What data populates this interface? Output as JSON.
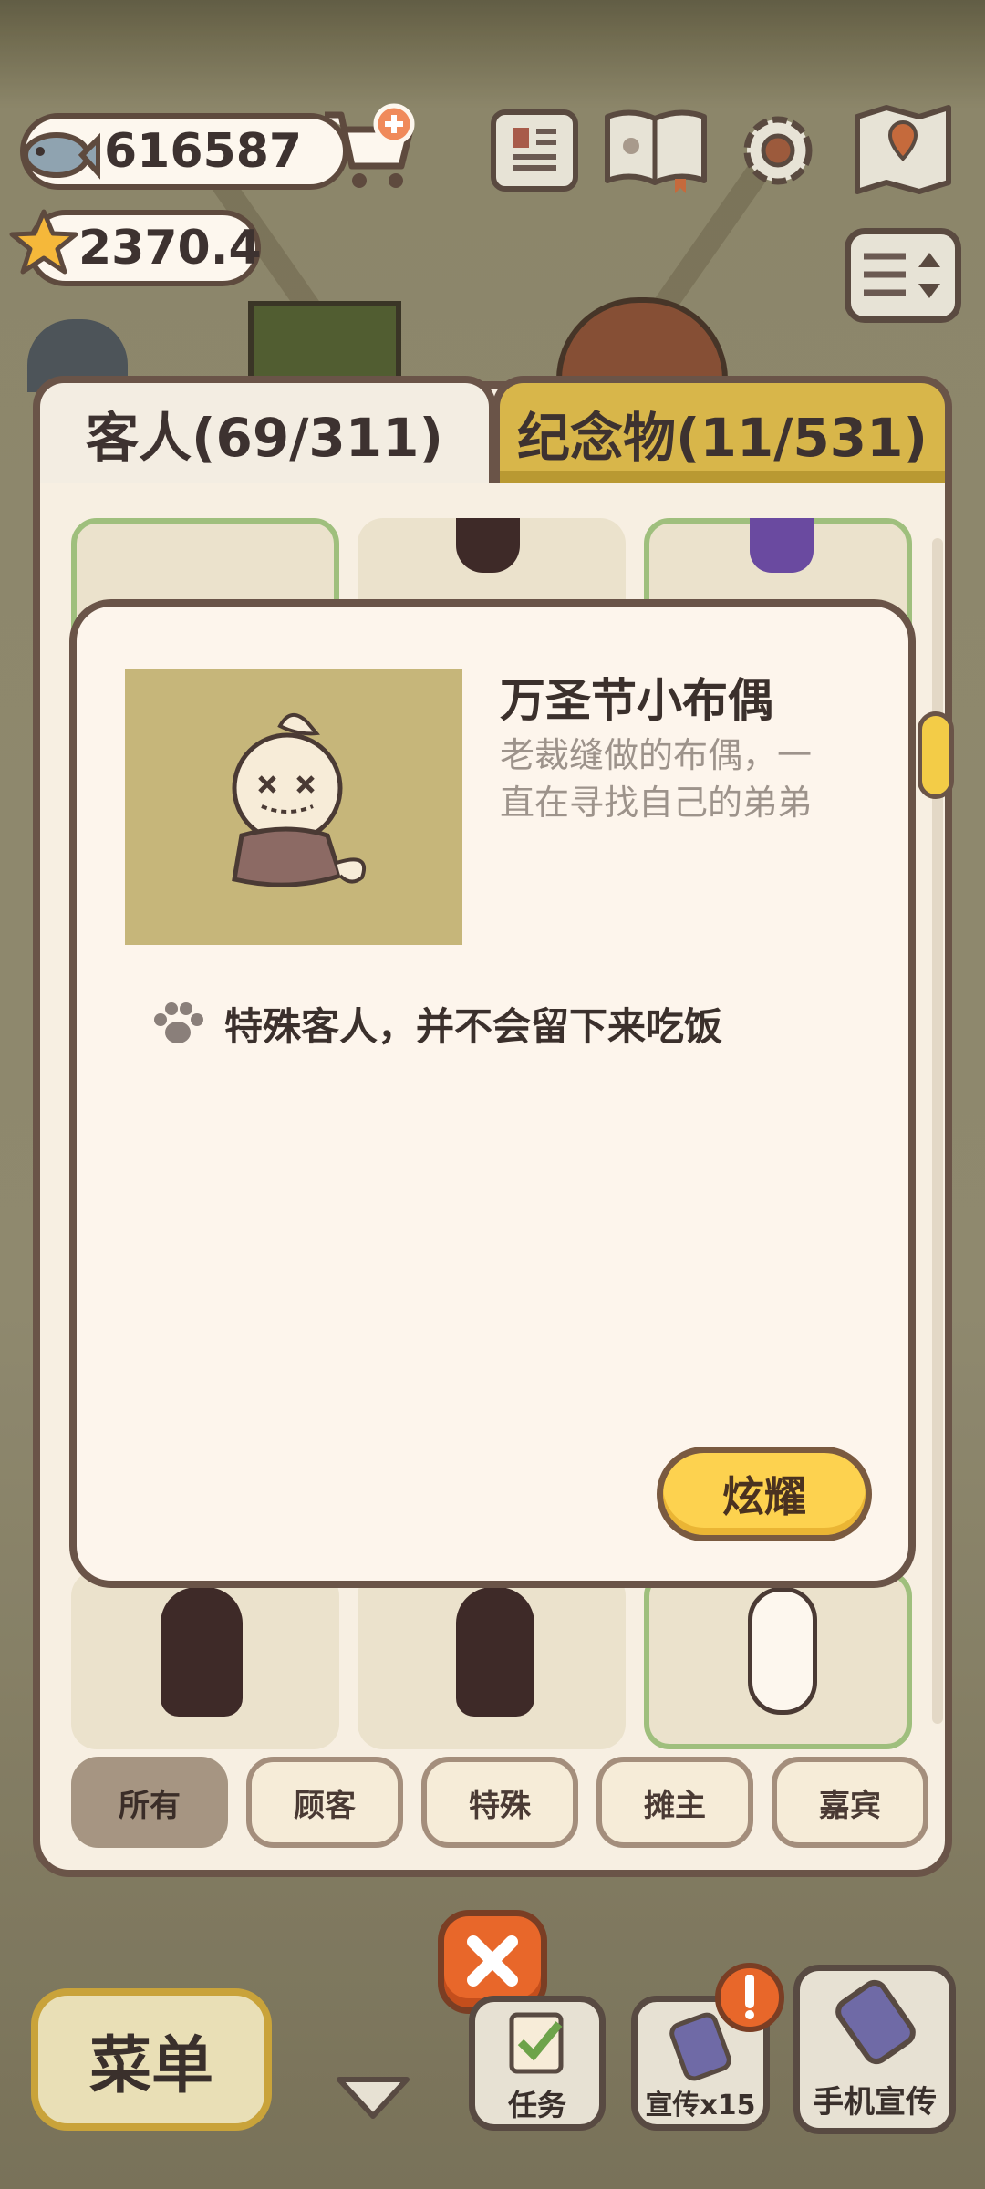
{
  "currency": {
    "fish": "616587",
    "stars": "2370.4"
  },
  "tabs": [
    {
      "label": "客人(69/311)"
    },
    {
      "label": "纪念物(11/531)"
    }
  ],
  "detail": {
    "name": "万圣节小布偶",
    "description_line1": "老裁缝做的布偶，一",
    "description_line2": "直在寻找自己的弟弟",
    "note": "特殊客人，并不会留下来吃饭",
    "show_button": "炫耀"
  },
  "filters": [
    {
      "label": "所有",
      "active": true
    },
    {
      "label": "顾客",
      "active": false
    },
    {
      "label": "特殊",
      "active": false
    },
    {
      "label": "摊主",
      "active": false
    },
    {
      "label": "嘉宾",
      "active": false
    }
  ],
  "bottom_bar": {
    "menu": "菜单",
    "tasks": "任务",
    "promote": "宣传x15",
    "phone_promote": "手机宣传"
  },
  "colors": {
    "tab_active": "#f3ede2",
    "tab_inactive": "#d8b64a",
    "button_yellow": "#fdd24f",
    "close_orange": "#e8672a",
    "outline_brown": "#6a5448"
  },
  "icons": [
    "fish-icon",
    "cart-plus-icon",
    "star-icon",
    "journal-icon",
    "book-icon",
    "gear-icon",
    "map-icon",
    "settings-slider-icon",
    "paw-icon",
    "close-icon",
    "chevron-down-icon",
    "checklist-icon",
    "phone-icon",
    "alert-icon"
  ]
}
